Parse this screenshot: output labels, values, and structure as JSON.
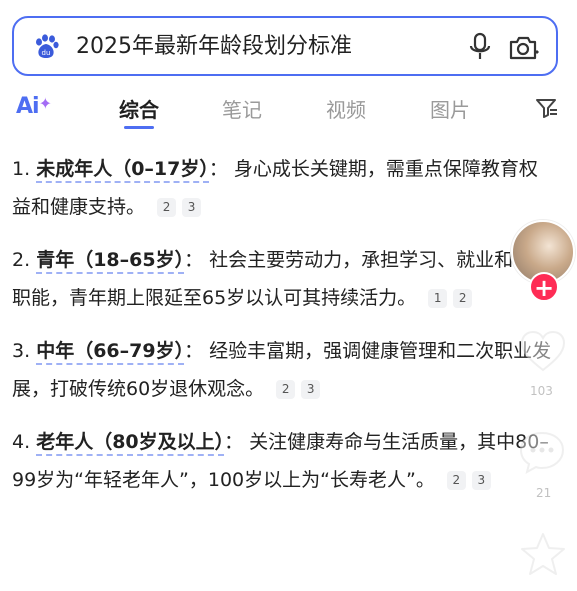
{
  "search": {
    "query": "2025年最新年龄段划分标准"
  },
  "tabs": {
    "ai_label": "Ai",
    "items": [
      "综合",
      "笔记",
      "视频",
      "图片"
    ]
  },
  "items": [
    {
      "number": "1.",
      "term": "未成年人（0–17岁）",
      "text": "：  身心成长关键期，需重点保障教育权益和健康支持。",
      "cites": [
        "2",
        "3"
      ]
    },
    {
      "number": "2.",
      "term": "青年（18–65岁）",
      "text": "：  社会主要劳动力，承担学习、就业和创新职能，青年期上限延至65岁以认可其持续活力。",
      "cites": [
        "1",
        "2"
      ]
    },
    {
      "number": "3.",
      "term": "中年（66–79岁）",
      "text": "：  经验丰富期，强调健康管理和二次职业发展，打破传统60岁退休观念。",
      "cites": [
        "2",
        "3"
      ]
    },
    {
      "number": "4.",
      "term": "老年人（80岁及以上）",
      "text": "：  关注健康寿命与生活质量，其中80–99岁为“年轻老年人”，100岁以上为“长寿老人”。",
      "cites": [
        "2",
        "3"
      ]
    }
  ],
  "side": {
    "follow_label": "+",
    "like_count": "103",
    "comment_count": "21"
  },
  "colors": {
    "accent": "#4e6ef2",
    "follow": "#fe2c55"
  }
}
